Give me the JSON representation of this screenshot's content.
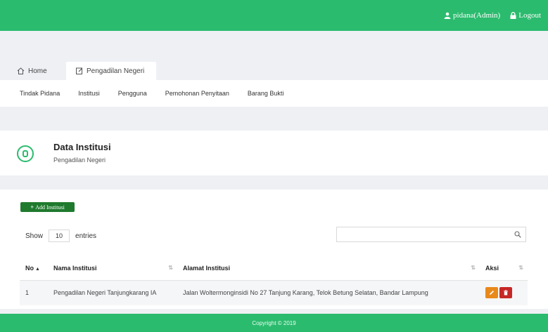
{
  "topbar": {
    "user_label": "pidana(Admin)",
    "logout_label": "Logout",
    "color": "#2bbb6e"
  },
  "tabs": {
    "home_label": "Home",
    "active_label": "Pengadilan Negeri"
  },
  "subnav": {
    "items": [
      "Tindak Pidana",
      "Institusi",
      "Pengguna",
      "Pemohonan Penyitaan",
      "Barang Bukti"
    ]
  },
  "header": {
    "title": "Data Institusi",
    "subtitle": "Pengadilan Negeri"
  },
  "content": {
    "add_button_label": "Add Institusi",
    "show_label": "Show",
    "entries_value": "10",
    "entries_label": "entries",
    "search_placeholder": ""
  },
  "table": {
    "columns": [
      "No",
      "Nama Institusi",
      "Alamat Institusi",
      "Aksi"
    ],
    "rows": [
      {
        "no": "1",
        "nama": "Pengadilan Negeri Tanjungkarang IA",
        "alamat": "Jalan Wolter­monginsidi No 27 Tanjung Karang, Telok Betung Selatan, Bandar Lampung"
      }
    ]
  },
  "footer": {
    "text": "Copyright © 2019"
  },
  "colors": {
    "accent": "#2bbb6e",
    "add_button": "#1f7a2e",
    "edit_button": "#e8891c",
    "delete_button": "#c62828"
  }
}
